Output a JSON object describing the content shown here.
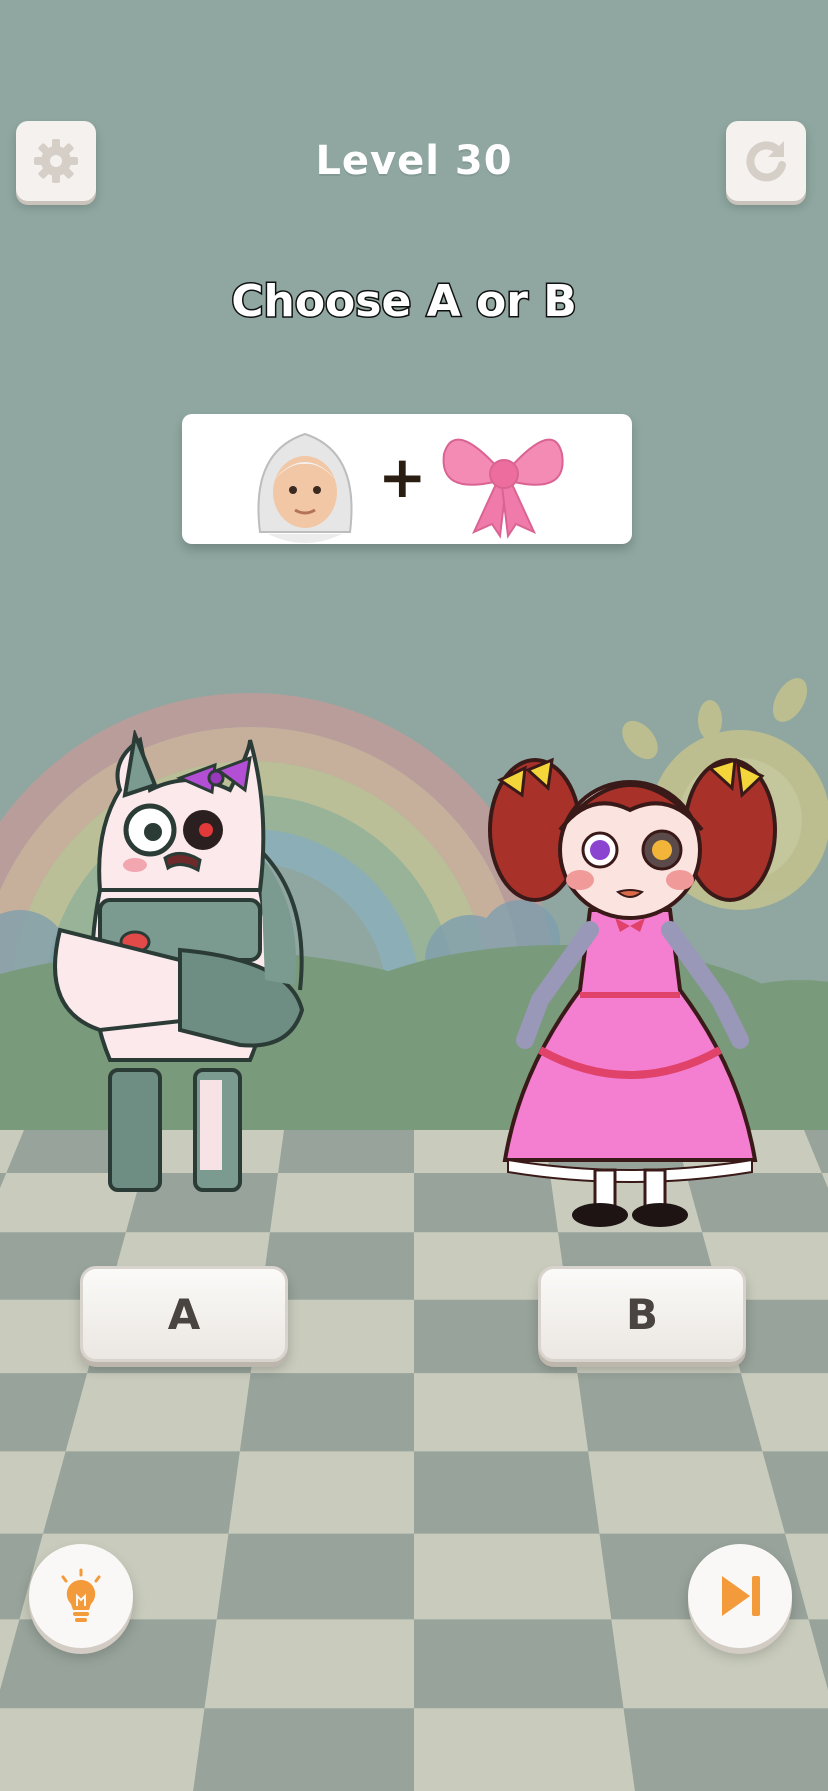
{
  "header": {
    "level_label": "Level 30",
    "settings_icon": "gear-icon",
    "restart_icon": "restart-icon"
  },
  "instruction": "Choose A or B",
  "clue": {
    "items": [
      "old-woman-emoji",
      "ribbon-bow-emoji"
    ],
    "operator": "+"
  },
  "options": {
    "a_label": "A",
    "b_label": "B"
  },
  "footer": {
    "hint_icon": "lightbulb-icon",
    "skip_icon": "skip-forward-icon"
  },
  "colors": {
    "sky": "#8fa7a0",
    "accent_orange": "#f39a3a",
    "bow_pink": "#f48bb5",
    "dress_pink": "#f47ed0"
  }
}
